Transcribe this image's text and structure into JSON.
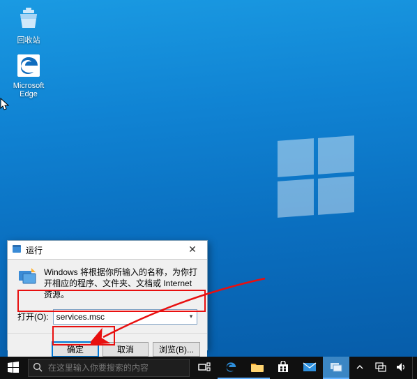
{
  "desktop": {
    "icons": {
      "recycle": "回收站",
      "edge": "Microsoft Edge"
    }
  },
  "run": {
    "title": "运行",
    "desc": "Windows 将根据你所输入的名称，为你打开相应的程序、文件夹、文档或 Internet 资源。",
    "open_label": "打开(O):",
    "open_value": "services.msc",
    "ok": "确定",
    "cancel": "取消",
    "browse": "浏览(B)..."
  },
  "taskbar": {
    "search_placeholder": "在这里输入你要搜索的内容"
  }
}
